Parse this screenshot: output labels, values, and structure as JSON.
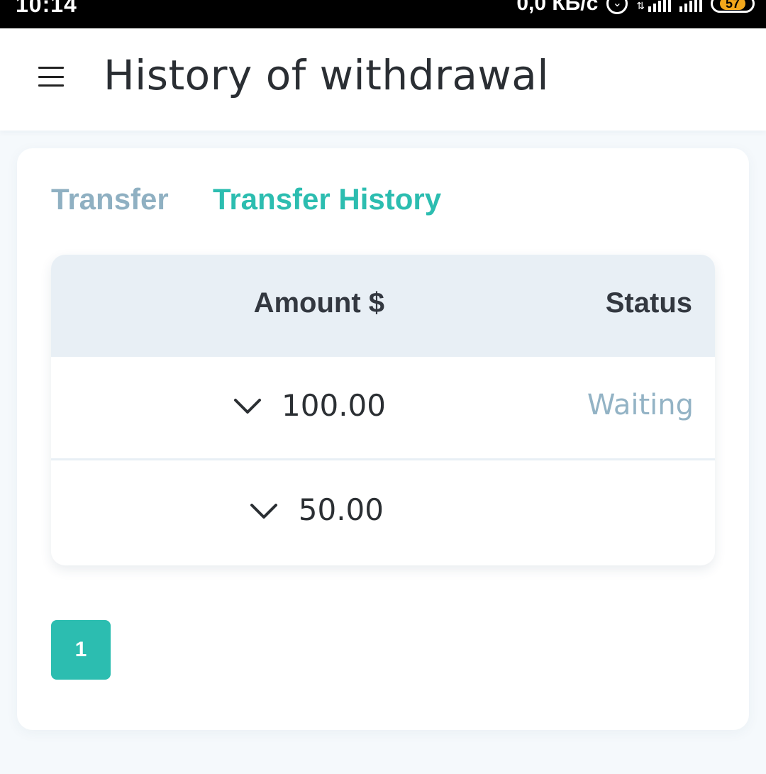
{
  "status_bar": {
    "time": "10:14",
    "net_speed": "0,0 КБ/с",
    "battery": "57"
  },
  "header": {
    "title": "History of withdrawal",
    "menu_icon": "hamburger-menu-icon"
  },
  "tabs": [
    {
      "label": "Transfer",
      "active": false
    },
    {
      "label": "Transfer History",
      "active": true
    }
  ],
  "table": {
    "columns": [
      "Amount $",
      "Status"
    ],
    "rows": [
      {
        "amount": "100.00",
        "status": "Waiting"
      },
      {
        "amount": "50.00",
        "status": ""
      }
    ]
  },
  "pagination": {
    "current_page": "1"
  },
  "colors": {
    "accent": "#2cbdb0",
    "inactive_tab": "#8fb0c2",
    "status_waiting": "#93b3c5",
    "table_header_bg": "#e8eff5"
  }
}
